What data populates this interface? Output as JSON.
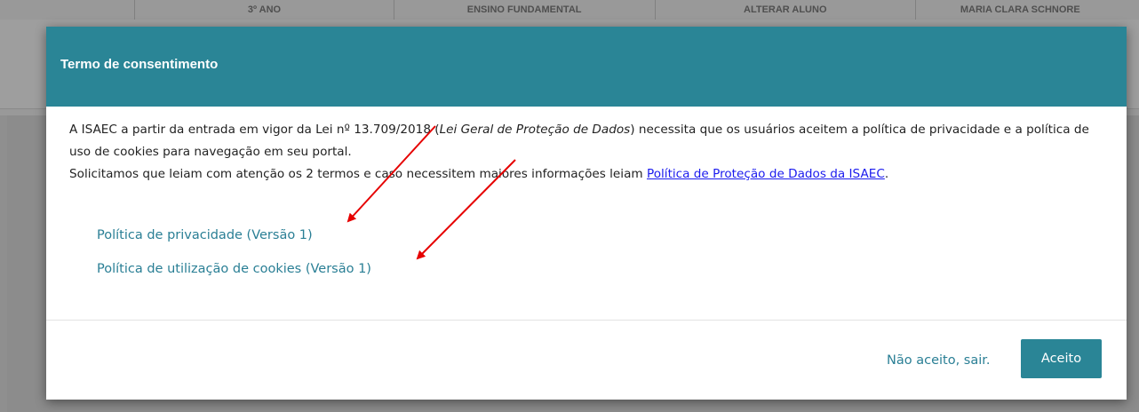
{
  "background_table": {
    "headers": [
      "",
      "3º ANO",
      "ENSINO FUNDAMENTAL",
      "ALTERAR ALUNO",
      "MARIA CLARA SCHNORE"
    ]
  },
  "modal": {
    "title": "Termo de consentimento",
    "body": {
      "line1_pre": "A ISAEC a partir da entrada em vigor da Lei nº 13.709/2018 (",
      "line1_em": "Lei Geral de Proteção de Dados",
      "line1_post": ") necessita que os usuários aceitem a política de privacidade e a política de uso de cookies para navegação em seu portal.",
      "line2_pre": "Solicitamos que leiam com atenção os 2 termos e caso necessitem maiores informações leiam ",
      "line2_link": "Política de Proteção de Dados da ISAEC",
      "line2_post": "."
    },
    "links": [
      {
        "label": "Política de privacidade (Versão 1)"
      },
      {
        "label": "Política de utilização de cookies (Versão 1)"
      }
    ],
    "footer": {
      "reject_label": "Não aceito, sair.",
      "accept_label": "Aceito"
    }
  },
  "colors": {
    "header_bg": "#2a8596",
    "link": "#2a7f95",
    "annotation_arrow": "#e60000"
  },
  "annotations": {
    "icon": "red-arrow-icon"
  }
}
